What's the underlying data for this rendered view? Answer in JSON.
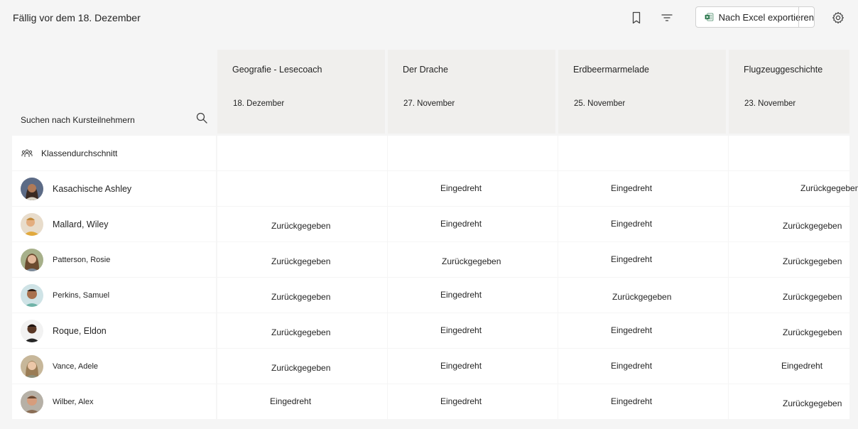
{
  "header": {
    "title": "Fällig vor dem 18. Dezember",
    "export_label": "Nach Excel exportieren"
  },
  "icons": {
    "bookmark": "bookmark-icon",
    "filter": "filter-icon",
    "settings": "gear-icon",
    "search": "search-icon",
    "excel": "excel-icon",
    "class_average": "people-icon"
  },
  "search": {
    "placeholder": "Suchen nach Kursteilnehmern"
  },
  "class_average_label": "Klassendurchschnitt",
  "assignments": [
    {
      "name": "Geografie - Lesecoach",
      "date": "18. Dezember"
    },
    {
      "name": "Der Drache",
      "date": "27. November"
    },
    {
      "name": "Erdbeermarmelade",
      "date": "25. November"
    },
    {
      "name": "Flugzeuggeschichte",
      "date": "23. November"
    }
  ],
  "students": [
    {
      "name": "Kasachische Ashley",
      "statuses": [
        "",
        "Eingedreht",
        "Eingedreht",
        "Zurückgegeben"
      ]
    },
    {
      "name": "Mallard, Wiley",
      "statuses": [
        "Zurückgegeben",
        "Eingedreht",
        "Eingedreht",
        "Zurückgegeben"
      ]
    },
    {
      "name": "Patterson, Rosie",
      "statuses": [
        "Zurückgegeben",
        "Zurückgegeben",
        "Eingedreht",
        "Zurückgegeben"
      ]
    },
    {
      "name": "Perkins, Samuel",
      "statuses": [
        "Zurückgegeben",
        "Eingedreht",
        "Zurückgegeben",
        "Zurückgegeben"
      ]
    },
    {
      "name": "Roque, Eldon",
      "statuses": [
        "Zurückgegeben",
        "Eingedreht",
        "Eingedreht",
        "Zurückgegeben"
      ]
    },
    {
      "name": "Vance, Adele",
      "statuses": [
        "Zurückgegeben",
        "Eingedreht",
        "Eingedreht",
        "Eingedreht"
      ]
    },
    {
      "name": "Wilber, Alex",
      "statuses": [
        "Eingedreht",
        "Eingedreht",
        "Eingedreht",
        "Zurückgegeben"
      ]
    }
  ],
  "colors": {
    "background": "#f5f5f5",
    "header_column": "#f0efed",
    "excel_green": "#1d6f42"
  }
}
